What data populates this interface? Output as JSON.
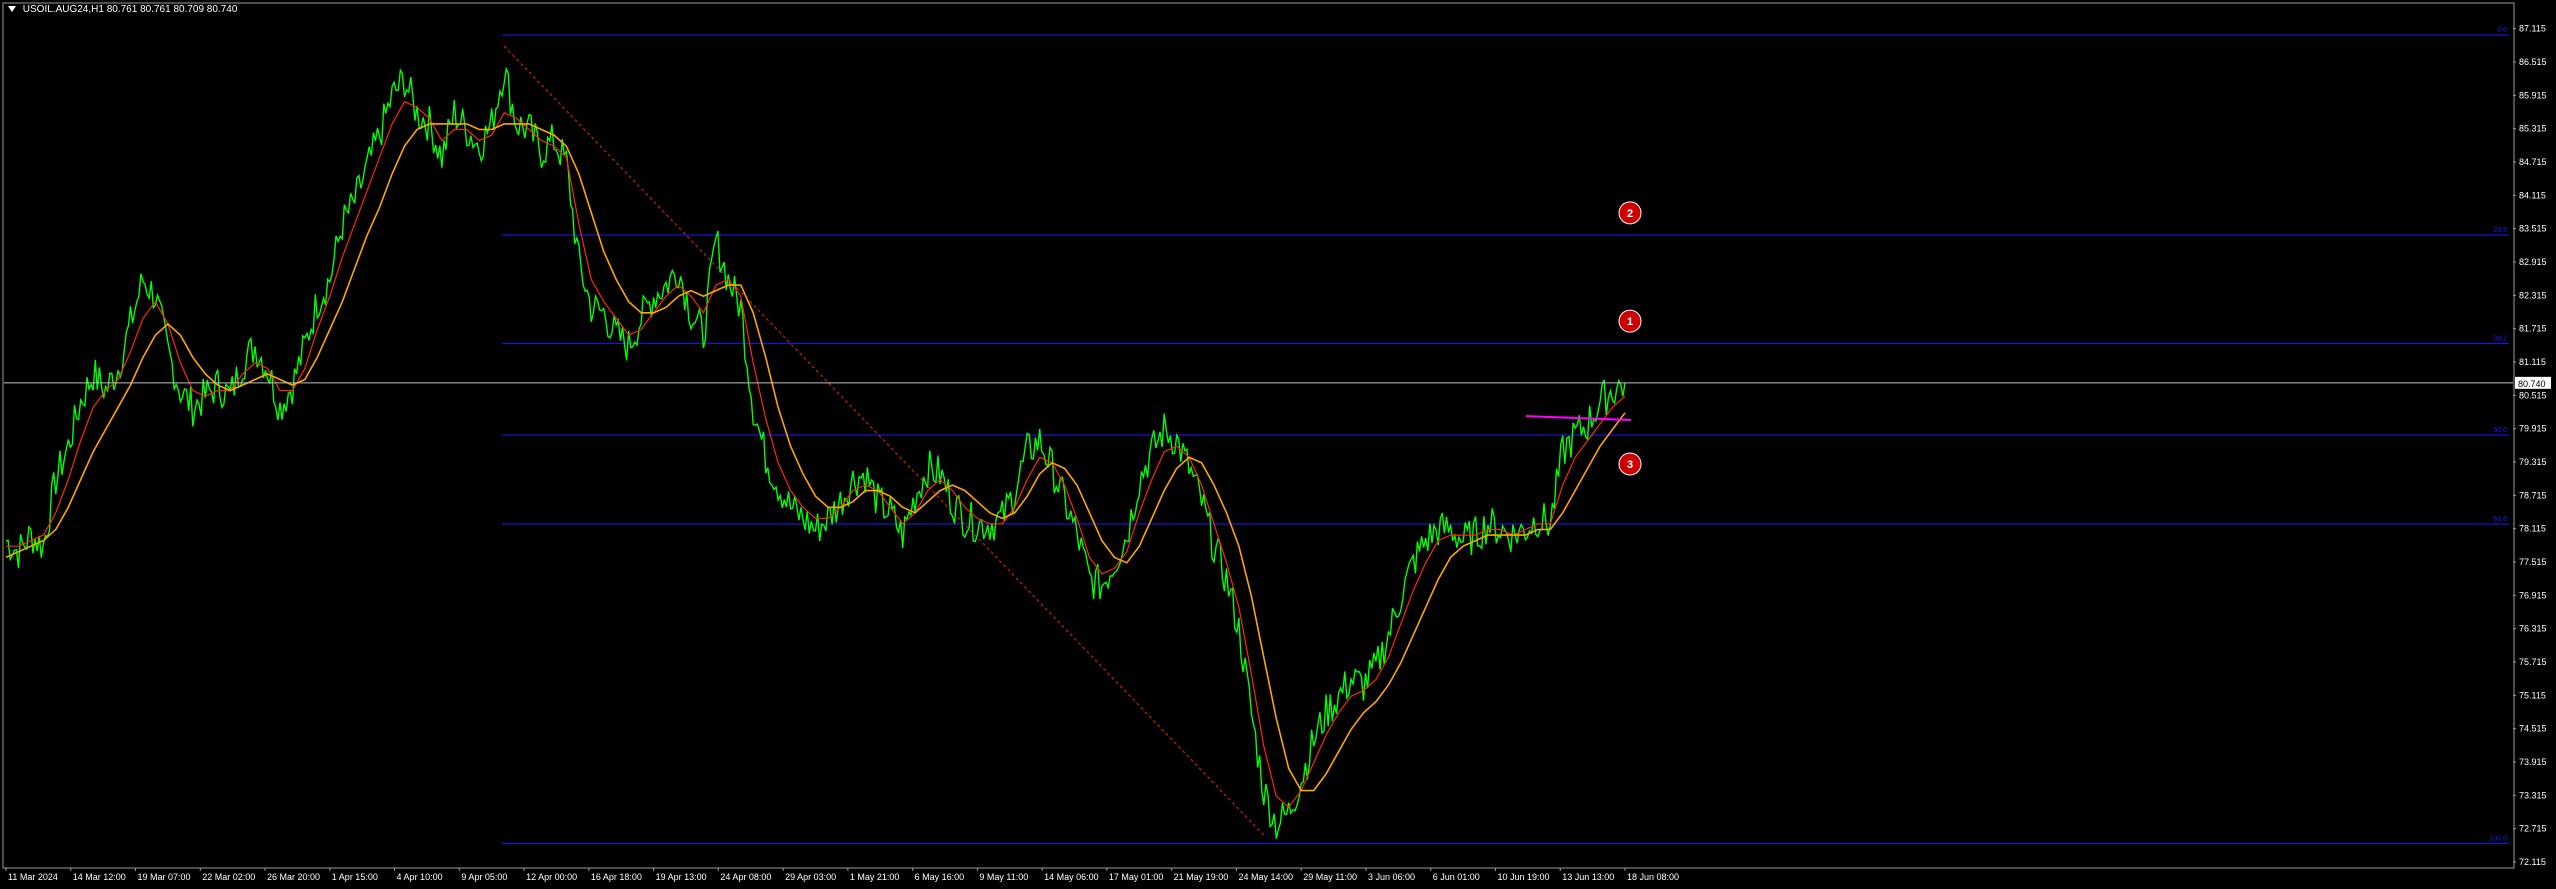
{
  "header": {
    "symbol": "USOIL.AUG24,H1",
    "ohlc": "80.761 80.761 80.709 80.740"
  },
  "colors": {
    "background": "#000000",
    "price": "#00ff00",
    "ma_fast": "#ff2a00",
    "ma_slow": "#ffa500",
    "fib": "#1a1aff",
    "trend": "#cc2200",
    "current_line": "#c0c0c0",
    "marker": "#cc0000",
    "magenta": "#ff00ff"
  },
  "chart_data": {
    "type": "line",
    "instrument": "USOIL.AUG24",
    "timeframe": "H1",
    "ylim": [
      72.115,
      87.415
    ],
    "y_ticks": [
      "87.115",
      "86.515",
      "85.915",
      "85.315",
      "84.715",
      "84.115",
      "83.515",
      "82.915",
      "82.315",
      "81.715",
      "81.115",
      "80.515",
      "79.915",
      "79.315",
      "78.715",
      "78.115",
      "77.515",
      "76.915",
      "76.315",
      "75.715",
      "75.115",
      "74.515",
      "73.915",
      "73.315",
      "72.715",
      "72.115"
    ],
    "x_ticks": [
      "11 Mar 2024",
      "14 Mar 12:00",
      "19 Mar 07:00",
      "22 Mar 02:00",
      "26 Mar 20:00",
      "1 Apr 15:00",
      "4 Apr 10:00",
      "9 Apr 05:00",
      "12 Apr 00:00",
      "16 Apr 18:00",
      "19 Apr 13:00",
      "24 Apr 08:00",
      "29 Apr 03:00",
      "1 May 21:00",
      "6 May 16:00",
      "9 May 11:00",
      "14 May 06:00",
      "17 May 01:00",
      "21 May 19:00",
      "24 May 14:00",
      "29 May 11:00",
      "3 Jun 06:00",
      "6 Jun 01:00",
      "10 Jun 19:00",
      "13 Jun 13:00",
      "18 Jun 08:00"
    ],
    "current_price": "80.740",
    "price_series": {
      "name": "",
      "x_index": [
        0,
        1,
        2,
        3,
        4,
        5,
        6,
        7,
        8,
        9,
        10,
        11,
        12,
        13,
        14,
        15,
        16,
        17,
        18,
        19,
        20,
        21,
        22,
        23,
        24,
        25,
        26,
        27,
        28,
        29,
        30,
        31,
        32,
        33,
        34,
        35,
        36,
        37,
        38,
        39,
        40,
        41,
        42,
        43,
        44,
        45,
        46,
        47,
        48,
        49,
        50,
        51,
        52,
        53,
        54,
        55,
        56,
        57,
        58,
        59,
        60,
        61,
        62,
        63,
        64,
        65,
        66,
        67,
        68,
        69,
        70,
        71,
        72,
        73,
        74,
        75,
        76,
        77,
        78,
        79,
        80,
        81,
        82,
        83,
        84,
        85,
        86,
        87,
        88,
        89,
        90,
        91,
        92,
        93,
        94,
        95,
        96,
        97,
        98,
        99,
        100,
        101,
        102,
        103,
        104,
        105,
        106,
        107,
        108,
        109,
        110,
        111,
        112,
        113,
        114,
        115,
        116,
        117,
        118,
        119,
        120,
        121,
        122,
        123,
        124,
        125,
        126,
        127,
        128,
        129,
        130
      ],
      "values": [
        77.9,
        77.7,
        78.0,
        77.8,
        79.0,
        79.6,
        80.4,
        80.9,
        80.6,
        81.0,
        81.8,
        82.6,
        82.3,
        81.3,
        80.6,
        80.3,
        80.5,
        80.7,
        80.5,
        81.1,
        81.4,
        81.0,
        80.3,
        80.7,
        81.4,
        82.2,
        82.6,
        83.6,
        84.0,
        84.6,
        85.2,
        85.9,
        86.2,
        85.6,
        85.4,
        84.8,
        85.6,
        85.3,
        85.0,
        85.4,
        86.4,
        85.4,
        85.3,
        84.9,
        85.1,
        84.7,
        82.9,
        82.1,
        82.0,
        81.6,
        81.4,
        81.9,
        82.3,
        82.5,
        82.8,
        82.0,
        81.6,
        83.3,
        82.6,
        82.1,
        80.3,
        79.4,
        78.9,
        78.5,
        78.3,
        78.1,
        78.3,
        78.6,
        79.0,
        79.1,
        78.6,
        78.4,
        78.0,
        78.7,
        79.2,
        79.1,
        78.6,
        78.3,
        78.2,
        78.2,
        78.3,
        78.8,
        79.5,
        79.7,
        79.2,
        78.6,
        78.0,
        77.2,
        77.1,
        77.5,
        78.0,
        79.0,
        79.5,
        79.9,
        79.7,
        79.2,
        78.6,
        77.8,
        77.2,
        76.3,
        74.8,
        73.4,
        72.8,
        73.0,
        73.6,
        74.3,
        74.8,
        75.1,
        75.4,
        75.3,
        75.6,
        76.2,
        76.9,
        77.5,
        77.9,
        78.1,
        78.1,
        77.9,
        78.0,
        78.2,
        78.1,
        78.0,
        78.1,
        78.3,
        78.2,
        79.5,
        79.8,
        80.0,
        80.4,
        80.6,
        80.74
      ]
    },
    "ma_fast_values": [
      77.8,
      77.8,
      77.9,
      78.0,
      78.4,
      79.0,
      79.7,
      80.3,
      80.6,
      80.8,
      81.3,
      81.9,
      82.2,
      81.8,
      81.1,
      80.6,
      80.5,
      80.6,
      80.6,
      80.9,
      81.1,
      81.0,
      80.6,
      80.6,
      81.0,
      81.7,
      82.3,
      83.0,
      83.6,
      84.2,
      84.8,
      85.4,
      85.8,
      85.7,
      85.5,
      85.1,
      85.3,
      85.3,
      85.1,
      85.2,
      85.6,
      85.5,
      85.3,
      85.1,
      85.0,
      84.8,
      83.6,
      82.6,
      82.2,
      81.9,
      81.6,
      81.7,
      82.0,
      82.3,
      82.5,
      82.3,
      82.0,
      82.5,
      82.6,
      82.3,
      81.1,
      80.1,
      79.3,
      78.8,
      78.5,
      78.3,
      78.3,
      78.5,
      78.8,
      78.9,
      78.8,
      78.5,
      78.2,
      78.4,
      78.8,
      79.0,
      78.8,
      78.5,
      78.3,
      78.2,
      78.2,
      78.5,
      79.0,
      79.4,
      79.3,
      78.9,
      78.3,
      77.6,
      77.3,
      77.4,
      77.7,
      78.4,
      79.0,
      79.5,
      79.6,
      79.4,
      78.9,
      78.2,
      77.5,
      76.7,
      75.5,
      74.2,
      73.3,
      73.1,
      73.4,
      73.9,
      74.4,
      74.8,
      75.1,
      75.2,
      75.4,
      75.8,
      76.4,
      77.0,
      77.5,
      77.9,
      78.0,
      78.0,
      78.0,
      78.1,
      78.1,
      78.0,
      78.1,
      78.2,
      78.2,
      78.9,
      79.4,
      79.7,
      80.0,
      80.3,
      80.5
    ],
    "ma_slow_values": [
      77.6,
      77.7,
      77.8,
      77.9,
      78.1,
      78.5,
      79.0,
      79.5,
      79.9,
      80.3,
      80.7,
      81.2,
      81.6,
      81.8,
      81.6,
      81.2,
      80.9,
      80.7,
      80.6,
      80.7,
      80.8,
      80.9,
      80.8,
      80.7,
      80.8,
      81.2,
      81.7,
      82.2,
      82.8,
      83.4,
      83.9,
      84.5,
      85.0,
      85.3,
      85.4,
      85.4,
      85.4,
      85.4,
      85.3,
      85.3,
      85.4,
      85.4,
      85.4,
      85.3,
      85.2,
      85.0,
      84.5,
      83.8,
      83.1,
      82.6,
      82.2,
      82.0,
      82.0,
      82.1,
      82.3,
      82.4,
      82.3,
      82.4,
      82.5,
      82.5,
      82.0,
      81.2,
      80.3,
      79.6,
      79.1,
      78.7,
      78.5,
      78.5,
      78.6,
      78.8,
      78.8,
      78.7,
      78.5,
      78.4,
      78.6,
      78.8,
      78.9,
      78.8,
      78.6,
      78.4,
      78.3,
      78.4,
      78.7,
      79.1,
      79.3,
      79.2,
      78.9,
      78.4,
      77.9,
      77.6,
      77.5,
      77.8,
      78.3,
      78.8,
      79.2,
      79.4,
      79.3,
      78.9,
      78.4,
      77.8,
      76.9,
      75.8,
      74.7,
      73.8,
      73.4,
      73.4,
      73.7,
      74.1,
      74.5,
      74.8,
      75.0,
      75.3,
      75.7,
      76.2,
      76.7,
      77.2,
      77.6,
      77.8,
      77.9,
      78.0,
      78.0,
      78.0,
      78.0,
      78.1,
      78.1,
      78.4,
      78.8,
      79.2,
      79.6,
      79.9,
      80.2
    ],
    "fib_levels": [
      {
        "label": "0.0",
        "value": 87.0
      },
      {
        "label": "23.6",
        "value": 83.4
      },
      {
        "label": "38.2",
        "value": 81.45
      },
      {
        "label": "50.0",
        "value": 79.8
      },
      {
        "label": "61.8",
        "value": 78.2
      },
      {
        "label": "100.0",
        "value": 72.45
      }
    ],
    "trendline": {
      "from": {
        "x_index": 40,
        "y": 86.8
      },
      "to": {
        "x_index": 101,
        "y": 72.6
      }
    },
    "magenta_line": {
      "from": {
        "x_index": 123,
        "y": 80.14
      },
      "to": {
        "x_index": 130,
        "y": 80.07
      }
    },
    "markers": [
      {
        "label": "1",
        "x_index": 131,
        "y": 81.85
      },
      {
        "label": "2",
        "x_index": 131,
        "y": 83.8
      },
      {
        "label": "3",
        "x_index": 131,
        "y": 79.28
      }
    ]
  }
}
